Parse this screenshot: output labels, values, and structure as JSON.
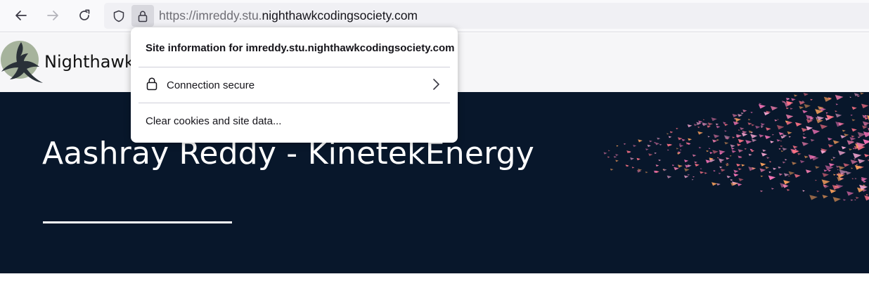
{
  "browser": {
    "url_prefix": "https://imreddy.stu.",
    "url_domain": "nighthawkcodingsociety.com"
  },
  "popup": {
    "title": "Site information for imreddy.stu.nighthawkcodingsociety.com",
    "connection_label": "Connection secure",
    "clear_label": "Clear cookies and site data..."
  },
  "site": {
    "name": "Nighthawk",
    "hero_title": "Aashray Reddy - KinetekEnergy"
  },
  "colors": {
    "hero_bg": "#08172b",
    "particle_pink": "#f472b6",
    "particle_orange": "#f59e5b"
  },
  "icons": [
    "back-arrow-icon",
    "forward-arrow-icon",
    "reload-icon",
    "shield-icon",
    "lock-icon",
    "chevron-right-icon",
    "nighthawk-logo"
  ]
}
